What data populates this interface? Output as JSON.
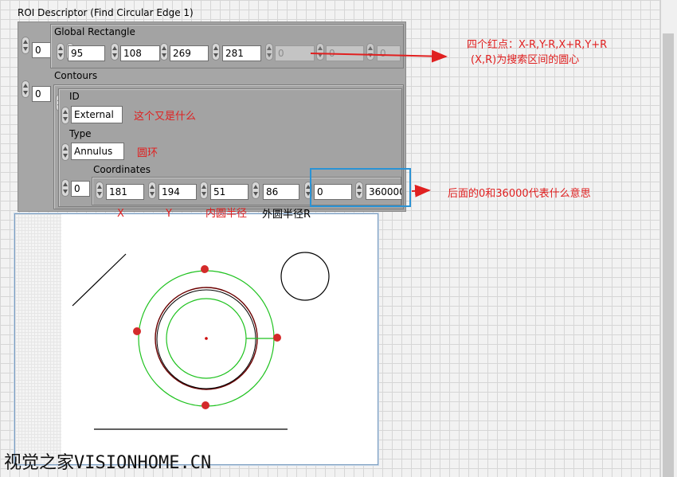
{
  "title": "ROI Descriptor (Find Circular Edge 1)",
  "global_rect": {
    "label": "Global Rectangle",
    "index": "0",
    "values": [
      "95",
      "108",
      "269",
      "281",
      "0",
      "0",
      "0"
    ]
  },
  "contours": {
    "label": "Contours",
    "index": "0",
    "inner_index": "0",
    "id_label": "ID",
    "id_value": "External",
    "type_label": "Type",
    "type_value": "Annulus",
    "coords_label": "Coordinates",
    "coords_index": "0",
    "coords": [
      "181",
      "194",
      "51",
      "86",
      "0",
      "360000"
    ]
  },
  "annotations": {
    "red_points_line1": "四个红点：X-R,Y-R,X+R,Y+R",
    "red_points_line2": "(X,R)为搜索区间的圆心",
    "id_question": "这个又是什么",
    "type_annulus": "圆环",
    "angle_question": "后面的0和36000代表什么意思",
    "x_label": "X",
    "y_label": "Y",
    "inner_radius": "内圆半径",
    "outer_radius": "外圆半径R"
  },
  "watermark": "视觉之家VISIONHOME.CN",
  "colors": {
    "annotation_red": "#e02020",
    "highlight_blue": "#2a93d5",
    "roi_green": "#1fc21f",
    "edge_dark_red": "#6b0000"
  }
}
